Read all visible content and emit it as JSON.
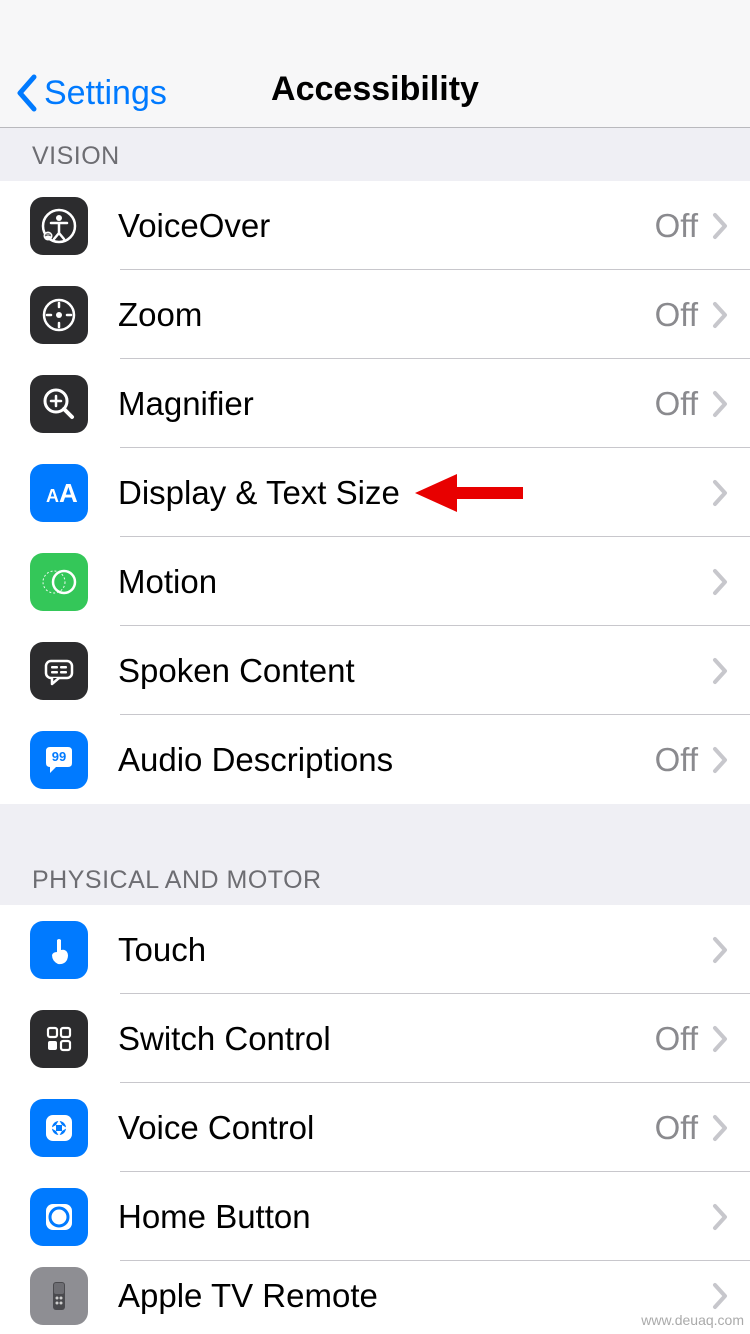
{
  "nav": {
    "back_label": "Settings",
    "title": "Accessibility"
  },
  "sections": [
    {
      "header": "VISION",
      "items": [
        {
          "id": "voiceover",
          "label": "VoiceOver",
          "value": "Off",
          "icon": "accessibility-icon",
          "bg": "bg-black"
        },
        {
          "id": "zoom",
          "label": "Zoom",
          "value": "Off",
          "icon": "zoom-target-icon",
          "bg": "bg-black"
        },
        {
          "id": "magnifier",
          "label": "Magnifier",
          "value": "Off",
          "icon": "magnifier-icon",
          "bg": "bg-black"
        },
        {
          "id": "display-text",
          "label": "Display & Text Size",
          "value": "",
          "icon": "text-size-icon",
          "bg": "bg-blue"
        },
        {
          "id": "motion",
          "label": "Motion",
          "value": "",
          "icon": "motion-icon",
          "bg": "bg-green"
        },
        {
          "id": "spoken-content",
          "label": "Spoken Content",
          "value": "",
          "icon": "speech-caption-icon",
          "bg": "bg-black"
        },
        {
          "id": "audio-desc",
          "label": "Audio Descriptions",
          "value": "Off",
          "icon": "audio-bubble-icon",
          "bg": "bg-blue"
        }
      ]
    },
    {
      "header": "PHYSICAL AND MOTOR",
      "items": [
        {
          "id": "touch",
          "label": "Touch",
          "value": "",
          "icon": "touch-icon",
          "bg": "bg-blue"
        },
        {
          "id": "switch-control",
          "label": "Switch Control",
          "value": "Off",
          "icon": "switch-grid-icon",
          "bg": "bg-black"
        },
        {
          "id": "voice-control",
          "label": "Voice Control",
          "value": "Off",
          "icon": "voice-control-icon",
          "bg": "bg-blue"
        },
        {
          "id": "home-button",
          "label": "Home Button",
          "value": "",
          "icon": "home-button-icon",
          "bg": "bg-blue"
        },
        {
          "id": "apple-tv-remote",
          "label": "Apple TV Remote",
          "value": "",
          "icon": "tv-remote-icon",
          "bg": "bg-gray"
        }
      ]
    }
  ],
  "annotation": {
    "arrow_target_row": "display-text"
  },
  "watermark": "www.deuaq.com"
}
